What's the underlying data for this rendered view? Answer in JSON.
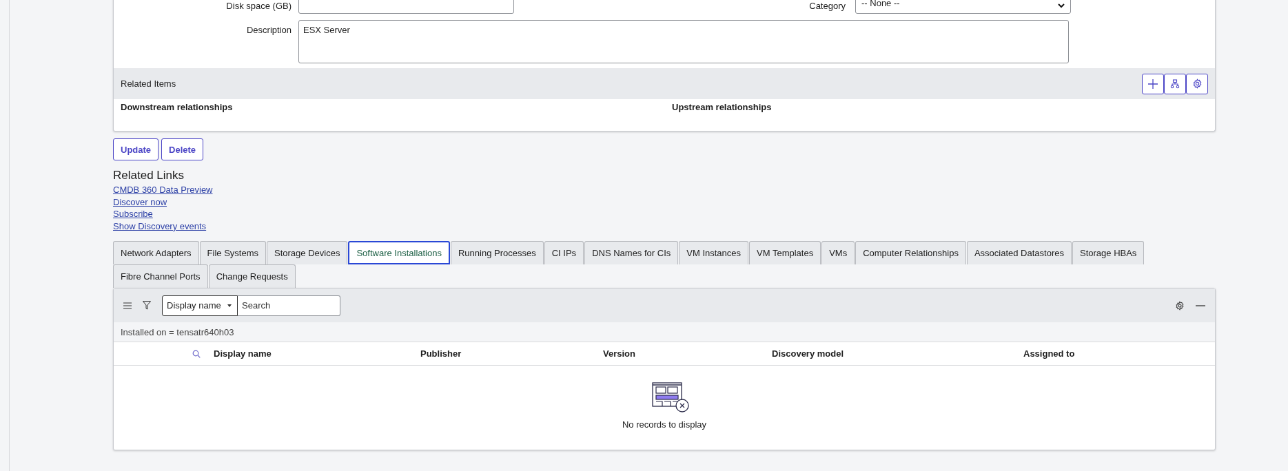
{
  "form": {
    "fields": [
      {
        "label": "Disk space (GB)",
        "kind": "text"
      },
      {
        "label": "Category",
        "kind": "select",
        "value": "-- None --"
      }
    ],
    "description": {
      "label": "Description",
      "value": "ESX Server"
    }
  },
  "related_items": {
    "title": "Related Items",
    "downstream": "Downstream relationships",
    "upstream": "Upstream relationships"
  },
  "buttons": [
    "Update",
    "Delete"
  ],
  "related_links": {
    "title": "Related Links",
    "links": [
      "CMDB 360 Data Preview",
      "Discover now",
      "Subscribe",
      "Show Discovery events"
    ]
  },
  "tabs": [
    {
      "label": "Network Adapters",
      "selected": false
    },
    {
      "label": "File Systems",
      "selected": false
    },
    {
      "label": "Storage Devices",
      "selected": false
    },
    {
      "label": "Software Installations",
      "selected": true
    },
    {
      "label": "Running Processes",
      "selected": false
    },
    {
      "label": "CI IPs",
      "selected": false
    },
    {
      "label": "DNS Names for CIs",
      "selected": false
    },
    {
      "label": "VM Instances",
      "selected": false
    },
    {
      "label": "VM Templates",
      "selected": false
    },
    {
      "label": "VMs",
      "selected": false
    },
    {
      "label": "Computer Relationships",
      "selected": false
    },
    {
      "label": "Associated Datastores",
      "selected": false
    },
    {
      "label": "Storage HBAs",
      "selected": false
    },
    {
      "label": "Fibre Channel Ports",
      "selected": false
    },
    {
      "label": "Change Requests",
      "selected": false
    }
  ],
  "list": {
    "search_field": "Display name",
    "search_placeholder": "Search",
    "breadcrumb": "Installed on = tensatr640h03",
    "columns": [
      "Display name",
      "Publisher",
      "Version",
      "Discovery model",
      "Assigned to"
    ],
    "empty_message": "No records to display"
  }
}
